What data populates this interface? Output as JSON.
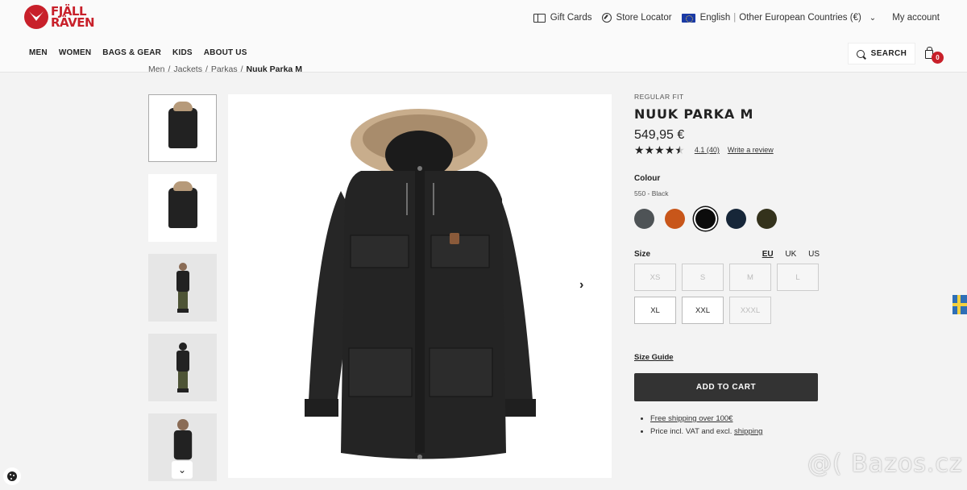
{
  "brand": {
    "line1": "FJÄLL",
    "line2": "RÄVEN",
    "color": "#c8202a"
  },
  "toplinks": {
    "gift": "Gift Cards",
    "store": "Store Locator",
    "language": "English",
    "region": "Other European Countries (€)",
    "account": "My account"
  },
  "nav": [
    "MEN",
    "WOMEN",
    "BAGS & GEAR",
    "KIDS",
    "ABOUT US"
  ],
  "search_label": "SEARCH",
  "cart_count": "0",
  "breadcrumb": [
    "Men",
    "/",
    "Jackets",
    "/",
    "Parkas",
    "/",
    "Nuuk Parka M"
  ],
  "product": {
    "fit": "REGULAR FIT",
    "name": "NUUK PARKA M",
    "price": "549,95 €",
    "rating_value": 4.1,
    "rating_text": "4.1",
    "review_count": "(40)",
    "write_review": "Write a review",
    "colour_label": "Colour",
    "colour_selected": "550 - Black",
    "swatches": [
      "#4e5356",
      "#c8561a",
      "#0c0c0c",
      "#162638",
      "#34321c"
    ],
    "selected_swatch": 2,
    "size_label": "Size",
    "size_units": [
      "EU",
      "UK",
      "US"
    ],
    "sizes": [
      {
        "label": "XS",
        "available": false
      },
      {
        "label": "S",
        "available": false
      },
      {
        "label": "M",
        "available": false
      },
      {
        "label": "L",
        "available": false
      },
      {
        "label": "XL",
        "available": true
      },
      {
        "label": "XXL",
        "available": true
      },
      {
        "label": "XXXL",
        "available": false
      }
    ],
    "size_guide": "Size Guide",
    "add_to_cart": "ADD TO CART",
    "shipping_note": "Free shipping over 100€",
    "vat_note": "Price incl. VAT and excl.",
    "vat_link": "shipping"
  },
  "watermark": "@( Bazos.cz"
}
